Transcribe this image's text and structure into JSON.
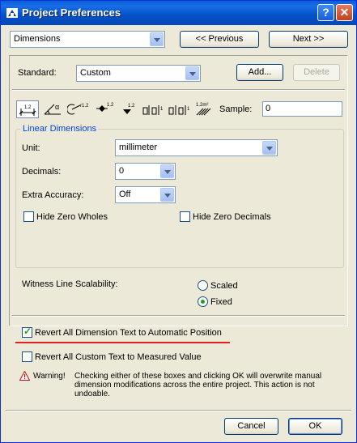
{
  "window": {
    "title": "Project Preferences"
  },
  "titlebar": {
    "help_label": "?",
    "close_label": "✕"
  },
  "nav": {
    "section_select": "Dimensions",
    "previous_label": "<< Previous",
    "next_label": "Next >>"
  },
  "standard": {
    "label": "Standard:",
    "value": "Custom",
    "add_label": "Add...",
    "delete_label": "Delete"
  },
  "toolbar": {
    "tools": [
      {
        "name": "linear-dimension-tool",
        "glyph": "↔",
        "sup": "1.2",
        "active": true
      },
      {
        "name": "angle-dimension-tool",
        "glyph": "∠",
        "sup": "α",
        "active": false
      },
      {
        "name": "radial-dimension-tool",
        "glyph": "⊙",
        "sup": "r1.2",
        "active": false
      },
      {
        "name": "level-dimension-tool",
        "glyph": "✦",
        "sup": "1.2",
        "active": false
      },
      {
        "name": "elevation-dimension-tool",
        "glyph": "▼",
        "sup": "1.2",
        "active": false
      },
      {
        "name": "door-window-dimension-tool",
        "glyph": "⩩",
        "sup": "",
        "active": false
      },
      {
        "name": "sill-height-tool",
        "glyph": "⩩",
        "sup": "",
        "active": false
      },
      {
        "name": "area-dimension-tool",
        "glyph": "▨",
        "sup": "1.2m²",
        "active": false
      }
    ],
    "sample_label": "Sample:",
    "sample_value": "0"
  },
  "linear": {
    "group_title": "Linear Dimensions",
    "unit_label": "Unit:",
    "unit_value": "millimeter",
    "decimals_label": "Decimals:",
    "decimals_value": "0",
    "accuracy_label": "Extra Accuracy:",
    "accuracy_value": "Off",
    "hide_zero_wholes_label": "Hide Zero Wholes",
    "hide_zero_wholes_checked": false,
    "hide_zero_decimals_label": "Hide Zero Decimals",
    "hide_zero_decimals_checked": false
  },
  "witness": {
    "label": "Witness Line Scalability:",
    "scaled_label": "Scaled",
    "fixed_label": "Fixed",
    "selected": "Fixed"
  },
  "revert": {
    "dimension_text_label": "Revert All Dimension Text to Automatic Position",
    "dimension_text_checked": true,
    "custom_text_label": "Revert All Custom Text to Measured Value",
    "custom_text_checked": false
  },
  "warning": {
    "title": "Warning!",
    "message": "Checking either of these boxes and clicking OK will overwrite manual dimension modifications across the entire project. This action is not undoable."
  },
  "footer": {
    "cancel_label": "Cancel",
    "ok_label": "OK"
  },
  "colors": {
    "titlebar": "#0451c6",
    "group_title": "#0046d5",
    "annotation_line": "#e12020",
    "check_mark": "#21a121"
  }
}
